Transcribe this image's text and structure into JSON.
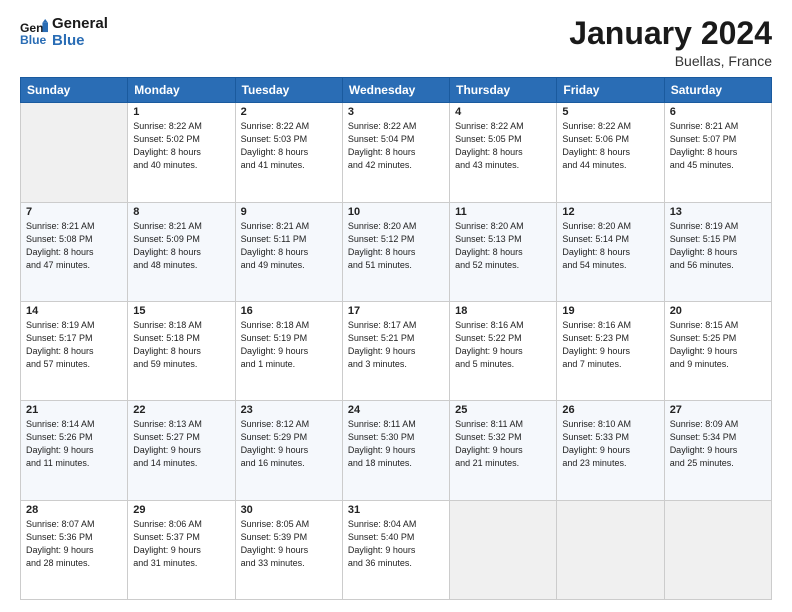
{
  "header": {
    "logo_line1": "General",
    "logo_line2": "Blue",
    "month": "January 2024",
    "location": "Buellas, France"
  },
  "days_of_week": [
    "Sunday",
    "Monday",
    "Tuesday",
    "Wednesday",
    "Thursday",
    "Friday",
    "Saturday"
  ],
  "weeks": [
    [
      {
        "day": "",
        "sunrise": "",
        "sunset": "",
        "daylight": ""
      },
      {
        "day": "1",
        "sunrise": "Sunrise: 8:22 AM",
        "sunset": "Sunset: 5:02 PM",
        "daylight": "Daylight: 8 hours and 40 minutes."
      },
      {
        "day": "2",
        "sunrise": "Sunrise: 8:22 AM",
        "sunset": "Sunset: 5:03 PM",
        "daylight": "Daylight: 8 hours and 41 minutes."
      },
      {
        "day": "3",
        "sunrise": "Sunrise: 8:22 AM",
        "sunset": "Sunset: 5:04 PM",
        "daylight": "Daylight: 8 hours and 42 minutes."
      },
      {
        "day": "4",
        "sunrise": "Sunrise: 8:22 AM",
        "sunset": "Sunset: 5:05 PM",
        "daylight": "Daylight: 8 hours and 43 minutes."
      },
      {
        "day": "5",
        "sunrise": "Sunrise: 8:22 AM",
        "sunset": "Sunset: 5:06 PM",
        "daylight": "Daylight: 8 hours and 44 minutes."
      },
      {
        "day": "6",
        "sunrise": "Sunrise: 8:21 AM",
        "sunset": "Sunset: 5:07 PM",
        "daylight": "Daylight: 8 hours and 45 minutes."
      }
    ],
    [
      {
        "day": "7",
        "sunrise": "Sunrise: 8:21 AM",
        "sunset": "Sunset: 5:08 PM",
        "daylight": "Daylight: 8 hours and 47 minutes."
      },
      {
        "day": "8",
        "sunrise": "Sunrise: 8:21 AM",
        "sunset": "Sunset: 5:09 PM",
        "daylight": "Daylight: 8 hours and 48 minutes."
      },
      {
        "day": "9",
        "sunrise": "Sunrise: 8:21 AM",
        "sunset": "Sunset: 5:11 PM",
        "daylight": "Daylight: 8 hours and 49 minutes."
      },
      {
        "day": "10",
        "sunrise": "Sunrise: 8:20 AM",
        "sunset": "Sunset: 5:12 PM",
        "daylight": "Daylight: 8 hours and 51 minutes."
      },
      {
        "day": "11",
        "sunrise": "Sunrise: 8:20 AM",
        "sunset": "Sunset: 5:13 PM",
        "daylight": "Daylight: 8 hours and 52 minutes."
      },
      {
        "day": "12",
        "sunrise": "Sunrise: 8:20 AM",
        "sunset": "Sunset: 5:14 PM",
        "daylight": "Daylight: 8 hours and 54 minutes."
      },
      {
        "day": "13",
        "sunrise": "Sunrise: 8:19 AM",
        "sunset": "Sunset: 5:15 PM",
        "daylight": "Daylight: 8 hours and 56 minutes."
      }
    ],
    [
      {
        "day": "14",
        "sunrise": "Sunrise: 8:19 AM",
        "sunset": "Sunset: 5:17 PM",
        "daylight": "Daylight: 8 hours and 57 minutes."
      },
      {
        "day": "15",
        "sunrise": "Sunrise: 8:18 AM",
        "sunset": "Sunset: 5:18 PM",
        "daylight": "Daylight: 8 hours and 59 minutes."
      },
      {
        "day": "16",
        "sunrise": "Sunrise: 8:18 AM",
        "sunset": "Sunset: 5:19 PM",
        "daylight": "Daylight: 9 hours and 1 minute."
      },
      {
        "day": "17",
        "sunrise": "Sunrise: 8:17 AM",
        "sunset": "Sunset: 5:21 PM",
        "daylight": "Daylight: 9 hours and 3 minutes."
      },
      {
        "day": "18",
        "sunrise": "Sunrise: 8:16 AM",
        "sunset": "Sunset: 5:22 PM",
        "daylight": "Daylight: 9 hours and 5 minutes."
      },
      {
        "day": "19",
        "sunrise": "Sunrise: 8:16 AM",
        "sunset": "Sunset: 5:23 PM",
        "daylight": "Daylight: 9 hours and 7 minutes."
      },
      {
        "day": "20",
        "sunrise": "Sunrise: 8:15 AM",
        "sunset": "Sunset: 5:25 PM",
        "daylight": "Daylight: 9 hours and 9 minutes."
      }
    ],
    [
      {
        "day": "21",
        "sunrise": "Sunrise: 8:14 AM",
        "sunset": "Sunset: 5:26 PM",
        "daylight": "Daylight: 9 hours and 11 minutes."
      },
      {
        "day": "22",
        "sunrise": "Sunrise: 8:13 AM",
        "sunset": "Sunset: 5:27 PM",
        "daylight": "Daylight: 9 hours and 14 minutes."
      },
      {
        "day": "23",
        "sunrise": "Sunrise: 8:12 AM",
        "sunset": "Sunset: 5:29 PM",
        "daylight": "Daylight: 9 hours and 16 minutes."
      },
      {
        "day": "24",
        "sunrise": "Sunrise: 8:11 AM",
        "sunset": "Sunset: 5:30 PM",
        "daylight": "Daylight: 9 hours and 18 minutes."
      },
      {
        "day": "25",
        "sunrise": "Sunrise: 8:11 AM",
        "sunset": "Sunset: 5:32 PM",
        "daylight": "Daylight: 9 hours and 21 minutes."
      },
      {
        "day": "26",
        "sunrise": "Sunrise: 8:10 AM",
        "sunset": "Sunset: 5:33 PM",
        "daylight": "Daylight: 9 hours and 23 minutes."
      },
      {
        "day": "27",
        "sunrise": "Sunrise: 8:09 AM",
        "sunset": "Sunset: 5:34 PM",
        "daylight": "Daylight: 9 hours and 25 minutes."
      }
    ],
    [
      {
        "day": "28",
        "sunrise": "Sunrise: 8:07 AM",
        "sunset": "Sunset: 5:36 PM",
        "daylight": "Daylight: 9 hours and 28 minutes."
      },
      {
        "day": "29",
        "sunrise": "Sunrise: 8:06 AM",
        "sunset": "Sunset: 5:37 PM",
        "daylight": "Daylight: 9 hours and 31 minutes."
      },
      {
        "day": "30",
        "sunrise": "Sunrise: 8:05 AM",
        "sunset": "Sunset: 5:39 PM",
        "daylight": "Daylight: 9 hours and 33 minutes."
      },
      {
        "day": "31",
        "sunrise": "Sunrise: 8:04 AM",
        "sunset": "Sunset: 5:40 PM",
        "daylight": "Daylight: 9 hours and 36 minutes."
      },
      {
        "day": "",
        "sunrise": "",
        "sunset": "",
        "daylight": ""
      },
      {
        "day": "",
        "sunrise": "",
        "sunset": "",
        "daylight": ""
      },
      {
        "day": "",
        "sunrise": "",
        "sunset": "",
        "daylight": ""
      }
    ]
  ]
}
